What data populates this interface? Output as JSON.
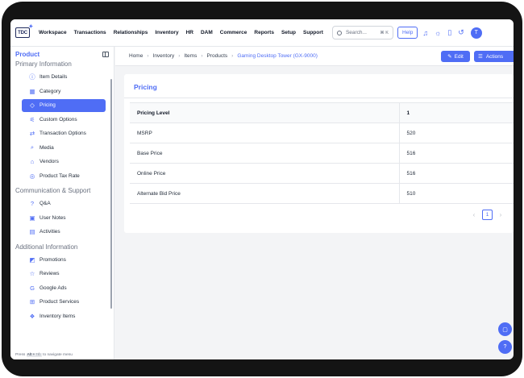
{
  "app": {
    "logo_text": "TDC",
    "logo_star": "✦"
  },
  "nav": {
    "links": [
      "Workspace",
      "Transactions",
      "Relationships",
      "Inventory",
      "HR",
      "DAM",
      "Commerce",
      "Reports",
      "Setup",
      "Support"
    ],
    "search_placeholder": "Search...",
    "search_shortcut": "⌘ K",
    "help_label": "Help",
    "icons": [
      "bell-icon",
      "sun-icon",
      "bookmark-icon",
      "history-icon"
    ],
    "avatar_initial": "T"
  },
  "sidebar": {
    "title": "Product",
    "sections": [
      {
        "label": "Primary Information",
        "items": [
          {
            "label": "Item Details",
            "icon": "ⓘ",
            "active": false
          },
          {
            "label": "Category",
            "icon": "▦",
            "active": false
          },
          {
            "label": "Pricing",
            "icon": "◇",
            "active": true
          },
          {
            "label": "Custom Options",
            "icon": "⚟",
            "active": false
          },
          {
            "label": "Transaction Options",
            "icon": "⇄",
            "active": false
          },
          {
            "label": "Media",
            "icon": "⌕",
            "active": false
          },
          {
            "label": "Vendors",
            "icon": "⌂",
            "active": false
          },
          {
            "label": "Product Tax Rate",
            "icon": "◎",
            "active": false
          }
        ]
      },
      {
        "label": "Communication & Support",
        "items": [
          {
            "label": "Q&A",
            "icon": "?",
            "active": false
          },
          {
            "label": "User Notes",
            "icon": "▣",
            "active": false
          },
          {
            "label": "Activities",
            "icon": "▤",
            "active": false
          }
        ]
      },
      {
        "label": "Additional Information",
        "items": [
          {
            "label": "Promotions",
            "icon": "◩",
            "active": false
          },
          {
            "label": "Reviews",
            "icon": "☆",
            "active": false
          },
          {
            "label": "Google Ads",
            "icon": "G",
            "active": false
          },
          {
            "label": "Product Services",
            "icon": "⊞",
            "active": false
          },
          {
            "label": "Inventory Items",
            "icon": "❖",
            "active": false
          }
        ]
      }
    ],
    "hint_prefix": "Press",
    "hint_keys": "Alt + ↑/↓",
    "hint_suffix": "to navigate menu"
  },
  "breadcrumb": [
    "Home",
    "Inventory",
    "Items",
    "Products",
    "Gaming Desktop Tower (GX-9000)"
  ],
  "actions": {
    "edit_label": "Edit",
    "actions_label": "Actions"
  },
  "pricing": {
    "title": "Pricing",
    "columns": [
      "Pricing Level",
      "1"
    ],
    "rows": [
      [
        "MSRP",
        "520"
      ],
      [
        "Base Price",
        "516"
      ],
      [
        "Online Price",
        "516"
      ],
      [
        "Alternate Bid Price",
        "510"
      ]
    ],
    "current_page": "1"
  },
  "colors": {
    "accent": "#4f6df5",
    "frame": "#141414",
    "background": "#f3f4f6"
  }
}
